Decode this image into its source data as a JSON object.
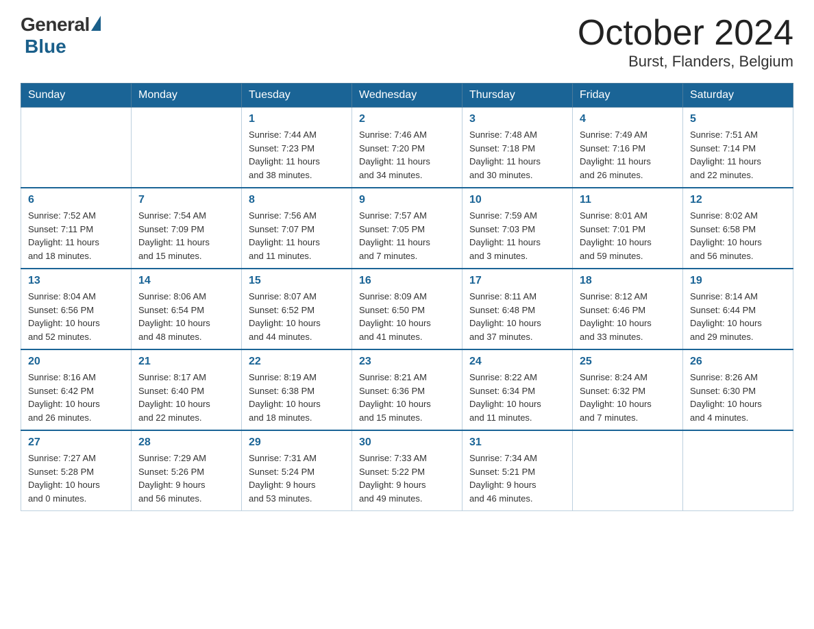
{
  "header": {
    "logo_general": "General",
    "logo_blue": "Blue",
    "month_title": "October 2024",
    "location": "Burst, Flanders, Belgium"
  },
  "days_of_week": [
    "Sunday",
    "Monday",
    "Tuesday",
    "Wednesday",
    "Thursday",
    "Friday",
    "Saturday"
  ],
  "weeks": [
    [
      {
        "day": "",
        "info": ""
      },
      {
        "day": "",
        "info": ""
      },
      {
        "day": "1",
        "info": "Sunrise: 7:44 AM\nSunset: 7:23 PM\nDaylight: 11 hours\nand 38 minutes."
      },
      {
        "day": "2",
        "info": "Sunrise: 7:46 AM\nSunset: 7:20 PM\nDaylight: 11 hours\nand 34 minutes."
      },
      {
        "day": "3",
        "info": "Sunrise: 7:48 AM\nSunset: 7:18 PM\nDaylight: 11 hours\nand 30 minutes."
      },
      {
        "day": "4",
        "info": "Sunrise: 7:49 AM\nSunset: 7:16 PM\nDaylight: 11 hours\nand 26 minutes."
      },
      {
        "day": "5",
        "info": "Sunrise: 7:51 AM\nSunset: 7:14 PM\nDaylight: 11 hours\nand 22 minutes."
      }
    ],
    [
      {
        "day": "6",
        "info": "Sunrise: 7:52 AM\nSunset: 7:11 PM\nDaylight: 11 hours\nand 18 minutes."
      },
      {
        "day": "7",
        "info": "Sunrise: 7:54 AM\nSunset: 7:09 PM\nDaylight: 11 hours\nand 15 minutes."
      },
      {
        "day": "8",
        "info": "Sunrise: 7:56 AM\nSunset: 7:07 PM\nDaylight: 11 hours\nand 11 minutes."
      },
      {
        "day": "9",
        "info": "Sunrise: 7:57 AM\nSunset: 7:05 PM\nDaylight: 11 hours\nand 7 minutes."
      },
      {
        "day": "10",
        "info": "Sunrise: 7:59 AM\nSunset: 7:03 PM\nDaylight: 11 hours\nand 3 minutes."
      },
      {
        "day": "11",
        "info": "Sunrise: 8:01 AM\nSunset: 7:01 PM\nDaylight: 10 hours\nand 59 minutes."
      },
      {
        "day": "12",
        "info": "Sunrise: 8:02 AM\nSunset: 6:58 PM\nDaylight: 10 hours\nand 56 minutes."
      }
    ],
    [
      {
        "day": "13",
        "info": "Sunrise: 8:04 AM\nSunset: 6:56 PM\nDaylight: 10 hours\nand 52 minutes."
      },
      {
        "day": "14",
        "info": "Sunrise: 8:06 AM\nSunset: 6:54 PM\nDaylight: 10 hours\nand 48 minutes."
      },
      {
        "day": "15",
        "info": "Sunrise: 8:07 AM\nSunset: 6:52 PM\nDaylight: 10 hours\nand 44 minutes."
      },
      {
        "day": "16",
        "info": "Sunrise: 8:09 AM\nSunset: 6:50 PM\nDaylight: 10 hours\nand 41 minutes."
      },
      {
        "day": "17",
        "info": "Sunrise: 8:11 AM\nSunset: 6:48 PM\nDaylight: 10 hours\nand 37 minutes."
      },
      {
        "day": "18",
        "info": "Sunrise: 8:12 AM\nSunset: 6:46 PM\nDaylight: 10 hours\nand 33 minutes."
      },
      {
        "day": "19",
        "info": "Sunrise: 8:14 AM\nSunset: 6:44 PM\nDaylight: 10 hours\nand 29 minutes."
      }
    ],
    [
      {
        "day": "20",
        "info": "Sunrise: 8:16 AM\nSunset: 6:42 PM\nDaylight: 10 hours\nand 26 minutes."
      },
      {
        "day": "21",
        "info": "Sunrise: 8:17 AM\nSunset: 6:40 PM\nDaylight: 10 hours\nand 22 minutes."
      },
      {
        "day": "22",
        "info": "Sunrise: 8:19 AM\nSunset: 6:38 PM\nDaylight: 10 hours\nand 18 minutes."
      },
      {
        "day": "23",
        "info": "Sunrise: 8:21 AM\nSunset: 6:36 PM\nDaylight: 10 hours\nand 15 minutes."
      },
      {
        "day": "24",
        "info": "Sunrise: 8:22 AM\nSunset: 6:34 PM\nDaylight: 10 hours\nand 11 minutes."
      },
      {
        "day": "25",
        "info": "Sunrise: 8:24 AM\nSunset: 6:32 PM\nDaylight: 10 hours\nand 7 minutes."
      },
      {
        "day": "26",
        "info": "Sunrise: 8:26 AM\nSunset: 6:30 PM\nDaylight: 10 hours\nand 4 minutes."
      }
    ],
    [
      {
        "day": "27",
        "info": "Sunrise: 7:27 AM\nSunset: 5:28 PM\nDaylight: 10 hours\nand 0 minutes."
      },
      {
        "day": "28",
        "info": "Sunrise: 7:29 AM\nSunset: 5:26 PM\nDaylight: 9 hours\nand 56 minutes."
      },
      {
        "day": "29",
        "info": "Sunrise: 7:31 AM\nSunset: 5:24 PM\nDaylight: 9 hours\nand 53 minutes."
      },
      {
        "day": "30",
        "info": "Sunrise: 7:33 AM\nSunset: 5:22 PM\nDaylight: 9 hours\nand 49 minutes."
      },
      {
        "day": "31",
        "info": "Sunrise: 7:34 AM\nSunset: 5:21 PM\nDaylight: 9 hours\nand 46 minutes."
      },
      {
        "day": "",
        "info": ""
      },
      {
        "day": "",
        "info": ""
      }
    ]
  ]
}
